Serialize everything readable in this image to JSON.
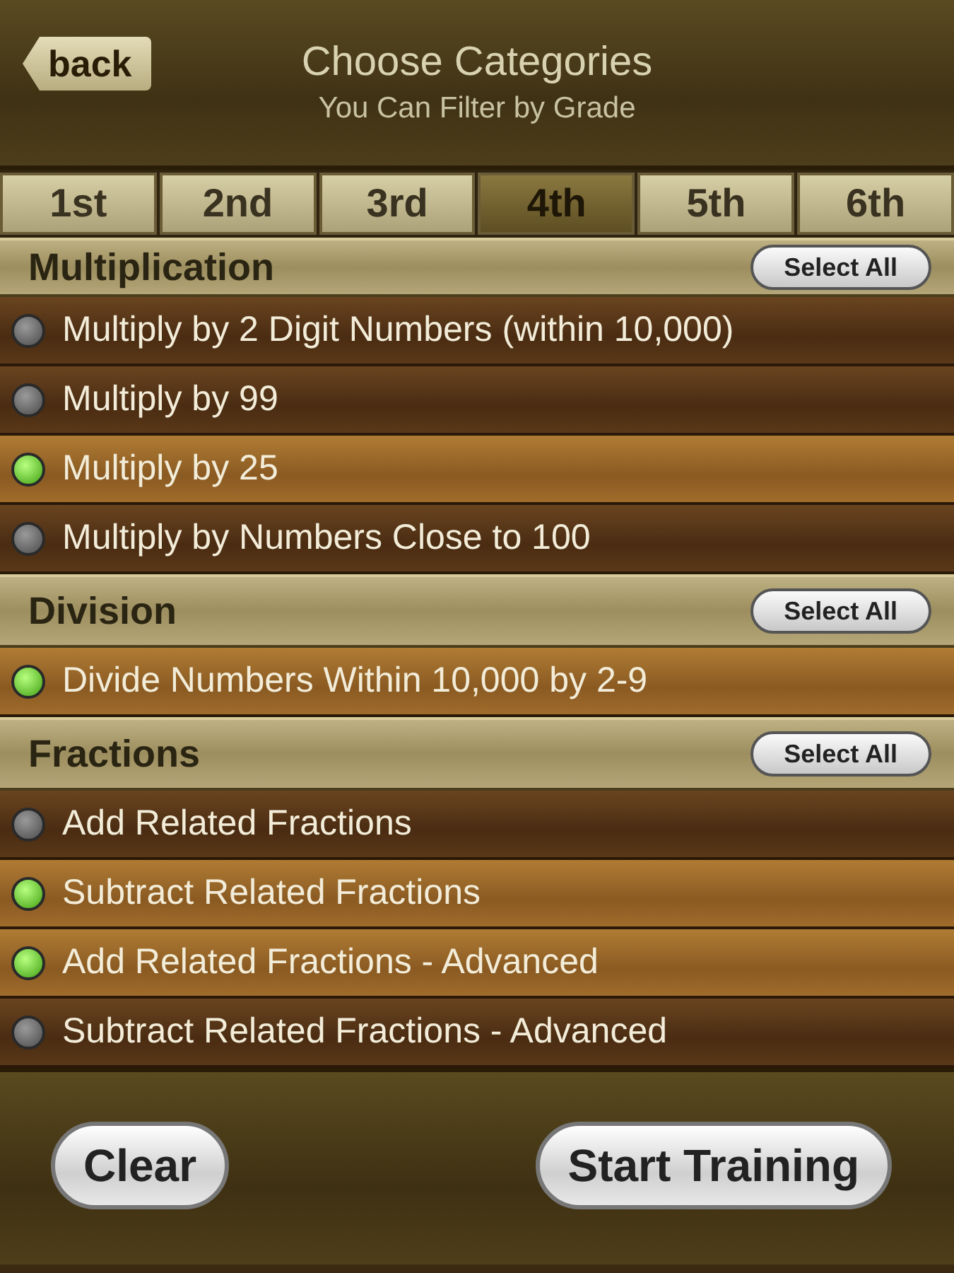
{
  "header": {
    "back": "back",
    "title": "Choose Categories",
    "subtitle": "You Can Filter by Grade"
  },
  "tabs": [
    {
      "label": "1st",
      "selected": false
    },
    {
      "label": "2nd",
      "selected": false
    },
    {
      "label": "3rd",
      "selected": false
    },
    {
      "label": "4th",
      "selected": true
    },
    {
      "label": "5th",
      "selected": false
    },
    {
      "label": "6th",
      "selected": false
    }
  ],
  "sections": [
    {
      "title": "Multiplication",
      "select_all": "Select All",
      "items": [
        {
          "label": "Multiply by 2 Digit Numbers (within 10,000)",
          "on": false
        },
        {
          "label": "Multiply by 99",
          "on": false
        },
        {
          "label": "Multiply by 25",
          "on": true
        },
        {
          "label": "Multiply by Numbers Close to 100",
          "on": false
        }
      ]
    },
    {
      "title": "Division",
      "select_all": "Select All",
      "items": [
        {
          "label": "Divide Numbers Within 10,000 by 2-9",
          "on": true
        }
      ]
    },
    {
      "title": "Fractions",
      "select_all": "Select All",
      "items": [
        {
          "label": "Add Related Fractions",
          "on": false
        },
        {
          "label": "Subtract Related Fractions",
          "on": true
        },
        {
          "label": "Add Related Fractions - Advanced",
          "on": true
        },
        {
          "label": "Subtract Related Fractions - Advanced",
          "on": false
        }
      ]
    }
  ],
  "footer": {
    "clear": "Clear",
    "start": "Start Training"
  }
}
